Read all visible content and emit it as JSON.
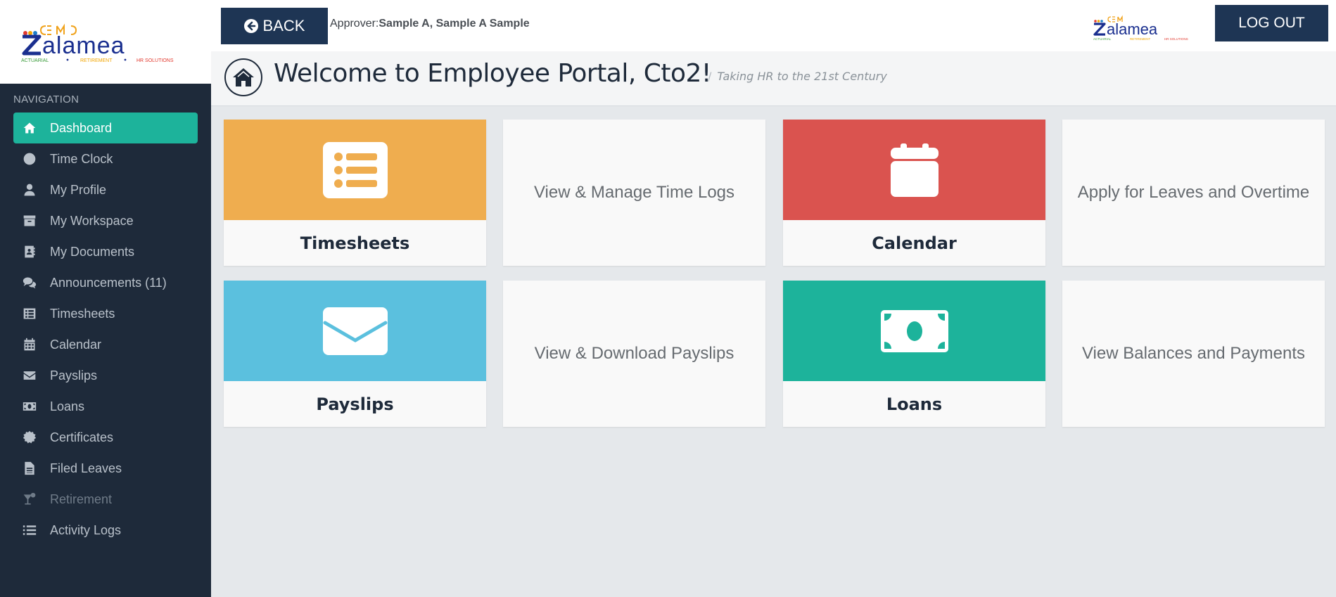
{
  "brand": {
    "logo_text": "Zalamea",
    "logo_tagline": "ACTUARIAL • RETIREMENT • HR SOLUTIONS",
    "colors": {
      "navy": "#1e3554",
      "sidebar": "#1e2a3a",
      "teal": "#1db39b",
      "orange": "#efad4f",
      "red": "#da534f",
      "blue": "#5bc0de"
    }
  },
  "sidebar": {
    "heading": "NAVIGATION",
    "items": [
      {
        "label": "Dashboard",
        "icon": "home-icon",
        "active": true
      },
      {
        "label": "Time Clock",
        "icon": "clock-icon"
      },
      {
        "label": "My Profile",
        "icon": "user-icon"
      },
      {
        "label": "My Workspace",
        "icon": "archive-icon"
      },
      {
        "label": "My Documents",
        "icon": "address-book-icon"
      },
      {
        "label": "Announcements (11)",
        "icon": "comments-icon"
      },
      {
        "label": "Timesheets",
        "icon": "list-icon"
      },
      {
        "label": "Calendar",
        "icon": "calendar-icon"
      },
      {
        "label": "Payslips",
        "icon": "envelope-icon"
      },
      {
        "label": "Loans",
        "icon": "money-icon"
      },
      {
        "label": "Certificates",
        "icon": "certificate-icon"
      },
      {
        "label": "Filed Leaves",
        "icon": "file-icon"
      },
      {
        "label": "Retirement",
        "icon": "cocktail-icon",
        "disabled": true
      },
      {
        "label": "Activity Logs",
        "icon": "list-ul-icon"
      }
    ]
  },
  "topbar": {
    "back_label": "BACK",
    "approver_label": "Approver:",
    "approver_names": "Sample A, Sample A Sample",
    "logout_label": "LOG OUT"
  },
  "header": {
    "title": "Welcome to Employee Portal, Cto2!",
    "subtitle": "Taking HR to the 21st Century"
  },
  "tiles": [
    {
      "label": "Timesheets",
      "icon": "list-icon",
      "color": "#efad4f"
    },
    {
      "description": "View & Manage Time Logs"
    },
    {
      "label": "Calendar",
      "icon": "calendar-icon",
      "color": "#da534f"
    },
    {
      "description": "Apply for Leaves and Overtime"
    },
    {
      "label": "Payslips",
      "icon": "envelope-icon",
      "color": "#5bc0de"
    },
    {
      "description": "View & Download Payslips"
    },
    {
      "label": "Loans",
      "icon": "money-icon",
      "color": "#1db39b"
    },
    {
      "description": "View Balances and Payments"
    }
  ]
}
